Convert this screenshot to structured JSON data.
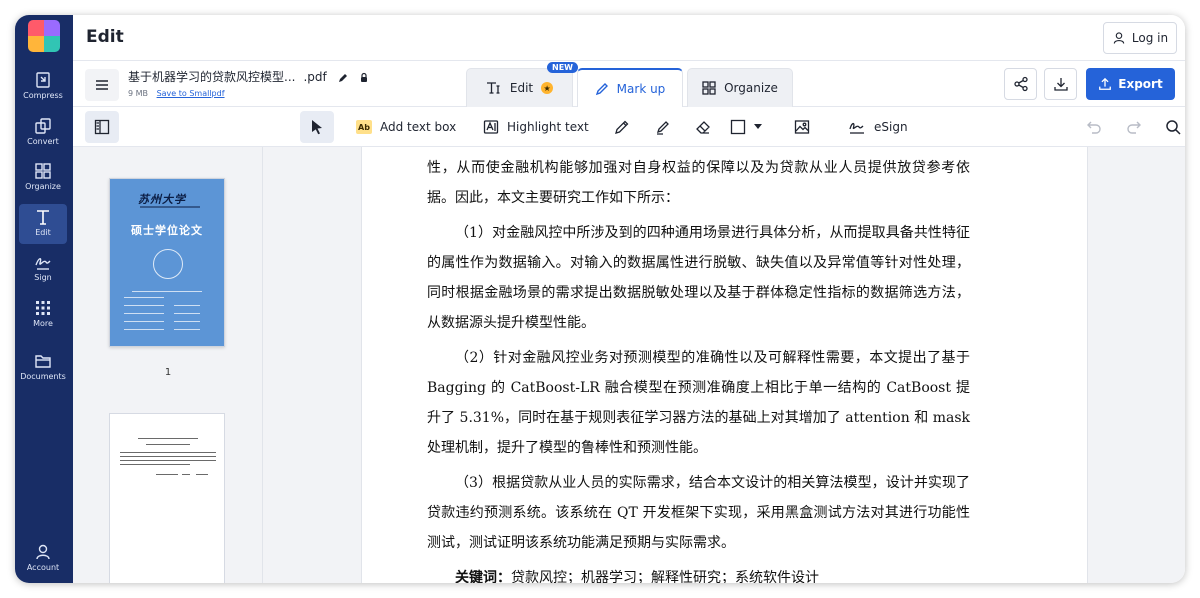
{
  "app": {
    "title": "Edit"
  },
  "sidebar": {
    "items": [
      {
        "label": "Compress",
        "icon": "compress-icon"
      },
      {
        "label": "Convert",
        "icon": "convert-icon"
      },
      {
        "label": "Organize",
        "icon": "organize-icon"
      },
      {
        "label": "Edit",
        "icon": "edit-icon",
        "active": true
      },
      {
        "label": "Sign",
        "icon": "sign-icon"
      },
      {
        "label": "More",
        "icon": "more-icon"
      },
      {
        "label": "Documents",
        "icon": "folder-icon"
      },
      {
        "label": "Account",
        "icon": "account-icon"
      }
    ]
  },
  "header": {
    "login_label": "Log in"
  },
  "file": {
    "name": "基于机器学习的贷款风控模型...",
    "ext": ".pdf",
    "size": "9 MB",
    "save_link": "Save to Smallpdf"
  },
  "tabs": [
    {
      "label": "Edit",
      "badge": "NEW"
    },
    {
      "label": "Mark up",
      "active": true
    },
    {
      "label": "Organize"
    }
  ],
  "actions": {
    "export_label": "Export"
  },
  "toolbar": {
    "add_text_box": "Add text box",
    "add_text_box_icon_text": "Ab",
    "highlight_text": "Highlight text",
    "esign": "eSign"
  },
  "thumbnails": {
    "page1_label": "1",
    "cover": {
      "school": "苏州大学",
      "title": "硕士学位论文"
    }
  },
  "document": {
    "paragraphs": [
      {
        "text": "性，从而使金融机构能够加强对自身权益的保障以及为贷款从业人员提供放贷参考依据。因此，本文主要研究工作如下所示：",
        "indent": false
      },
      {
        "text": "（1）对金融风控中所涉及到的四种通用场景进行具体分析，从而提取具备共性特征的属性作为数据输入。对输入的数据属性进行脱敏、缺失值以及异常值等针对性处理，同时根据金融场景的需求提出数据脱敏处理以及基于群体稳定性指标的数据筛选方法，从数据源头提升模型性能。",
        "indent": true
      },
      {
        "text": "（2）针对金融风控业务对预测模型的准确性以及可解释性需要，本文提出了基于 Bagging 的 CatBoost-LR 融合模型在预测准确度上相比于单一结构的 CatBoost 提升了 5.31%，同时在基于规则表征学习器方法的基础上对其增加了 attention 和 mask 处理机制，提升了模型的鲁棒性和预测性能。",
        "indent": true
      },
      {
        "text": "（3）根据贷款从业人员的实际需求，结合本文设计的相关算法模型，设计并实现了贷款违约预测系统。该系统在 QT 开发框架下实现，采用黑盒测试方法对其进行功能性测试，测试证明该系统功能满足预期与实际需求。",
        "indent": true
      }
    ],
    "keywords_label": "关键词：",
    "keywords": "贷款风控；机器学习；解释性研究；系统软件设计"
  },
  "colors": {
    "sidebar_bg": "#182d66",
    "accent": "#2563d9",
    "star": "#ffb42e",
    "thumb_cover": "#5c95d6"
  }
}
